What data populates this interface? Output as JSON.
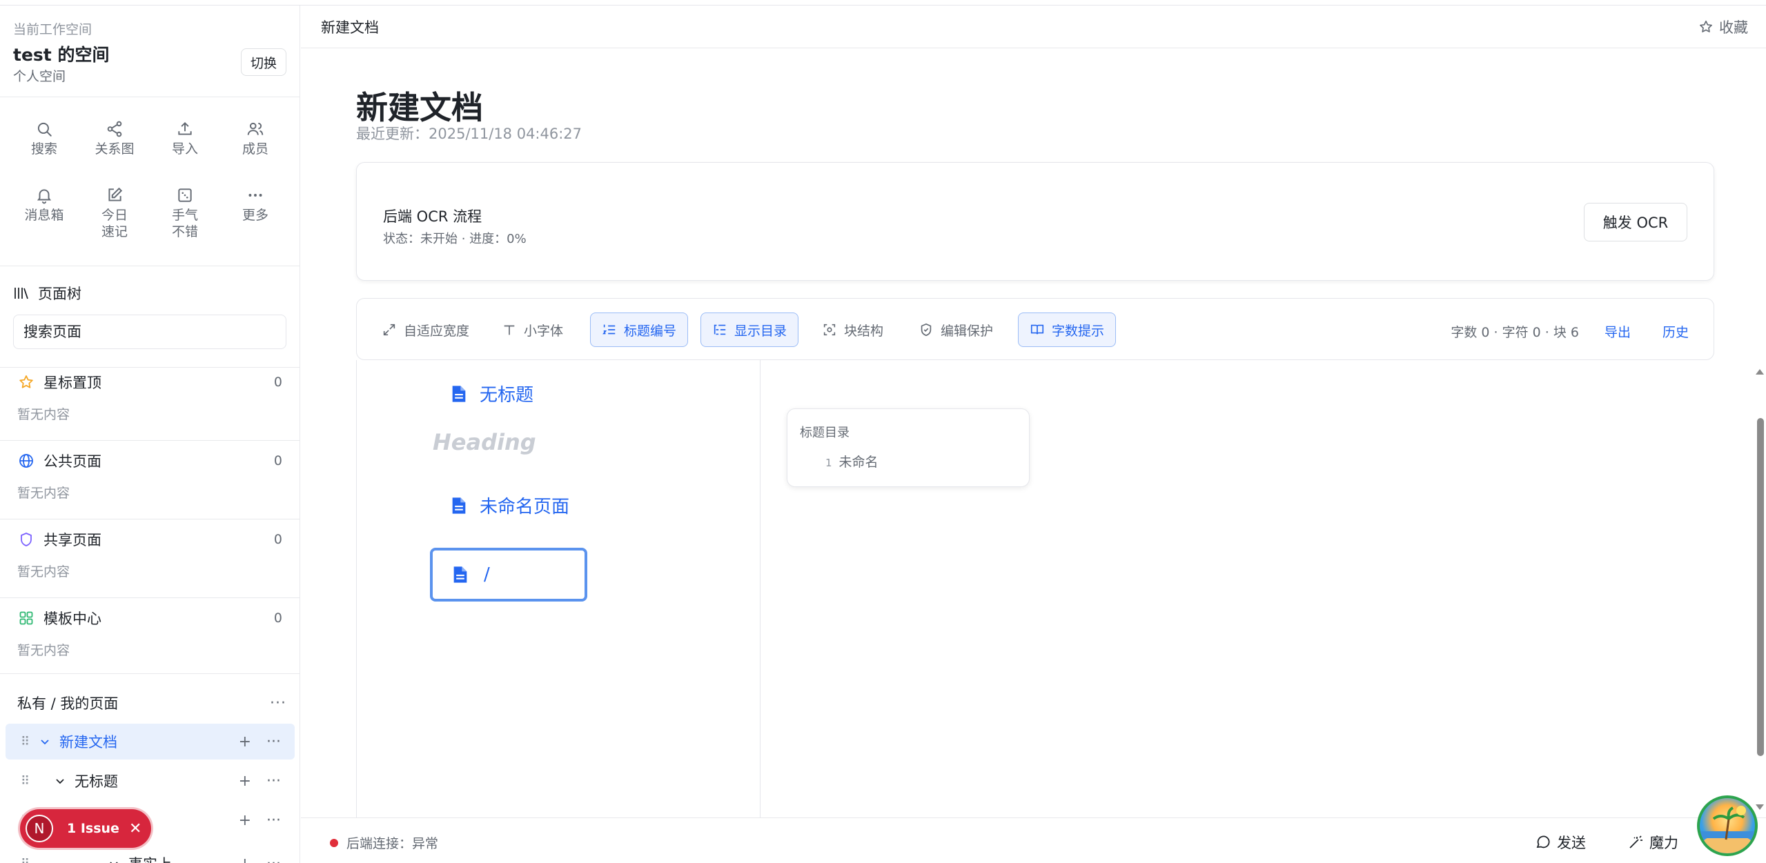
{
  "workspace": {
    "label": "当前工作空间",
    "name": "test 的空间",
    "type": "个人空间",
    "switch_label": "切换"
  },
  "quick_actions": [
    {
      "label": "搜索",
      "icon": "search-icon"
    },
    {
      "label": "关系图",
      "icon": "share-icon"
    },
    {
      "label": "导入",
      "icon": "upload-icon"
    },
    {
      "label": "成员",
      "icon": "users-icon"
    },
    {
      "label": "消息箱",
      "icon": "bell-icon"
    },
    {
      "label": "今日速记",
      "icon": "edit-icon"
    },
    {
      "label": "手气不错",
      "icon": "dice-icon"
    },
    {
      "label": "更多",
      "icon": "more-icon"
    }
  ],
  "page_tree": {
    "title": "页面树",
    "search_placeholder": "搜索页面"
  },
  "sections": [
    {
      "name": "星标置顶",
      "count": "0",
      "empty": "暂无内容",
      "icon": "star-icon",
      "color": "#f5a623"
    },
    {
      "name": "公共页面",
      "count": "0",
      "empty": "暂无内容",
      "icon": "globe-icon",
      "color": "#2466f0"
    },
    {
      "name": "共享页面",
      "count": "0",
      "empty": "暂无内容",
      "icon": "shield-icon",
      "color": "#7b61ff"
    },
    {
      "name": "模板中心",
      "count": "0",
      "empty": "暂无内容",
      "icon": "grid-icon",
      "color": "#2eb872"
    }
  ],
  "private": {
    "title": "私有 / 我的页面",
    "items": [
      {
        "label": "新建文档",
        "active": true
      },
      {
        "label": "无标题",
        "active": false
      },
      {
        "label": "",
        "active": false
      },
      {
        "label": "事实上",
        "active": false
      }
    ]
  },
  "issue_badge": {
    "letter": "N",
    "text": "1 Issue"
  },
  "header": {
    "breadcrumb": "新建文档",
    "favorite_label": "收藏"
  },
  "document": {
    "title": "新建文档",
    "updated": "最近更新：2025/11/18 04:46:27"
  },
  "ocr": {
    "title": "后端 OCR 流程",
    "status": "状态：未开始 · 进度：0%",
    "button": "触发 OCR"
  },
  "toolbar": {
    "items": [
      {
        "label": "自适应宽度",
        "on": false,
        "icon": "expand-icon"
      },
      {
        "label": "小字体",
        "on": false,
        "icon": "font-icon"
      },
      {
        "label": "标题编号",
        "on": true,
        "icon": "numbered-list-icon"
      },
      {
        "label": "显示目录",
        "on": true,
        "icon": "toc-icon"
      },
      {
        "label": "块结构",
        "on": false,
        "icon": "block-icon"
      },
      {
        "label": "编辑保护",
        "on": false,
        "icon": "shield-check-icon"
      },
      {
        "label": "字数提示",
        "on": true,
        "icon": "book-icon"
      }
    ],
    "stats": "字数 0 · 字符 0 · 块 6",
    "export_label": "导出",
    "history_label": "历史"
  },
  "editor": {
    "blocks": [
      "无标题",
      "未命名页面",
      "/"
    ],
    "heading_placeholder": "Heading"
  },
  "toc": {
    "title": "标题目录",
    "items": [
      {
        "num": "1",
        "label": "未命名"
      }
    ]
  },
  "footer": {
    "connection": "后端连接：异常",
    "send_label": "发送",
    "magic_label": "魔力"
  },
  "colors": {
    "accent": "#2466f0",
    "error": "#e02e3a"
  }
}
